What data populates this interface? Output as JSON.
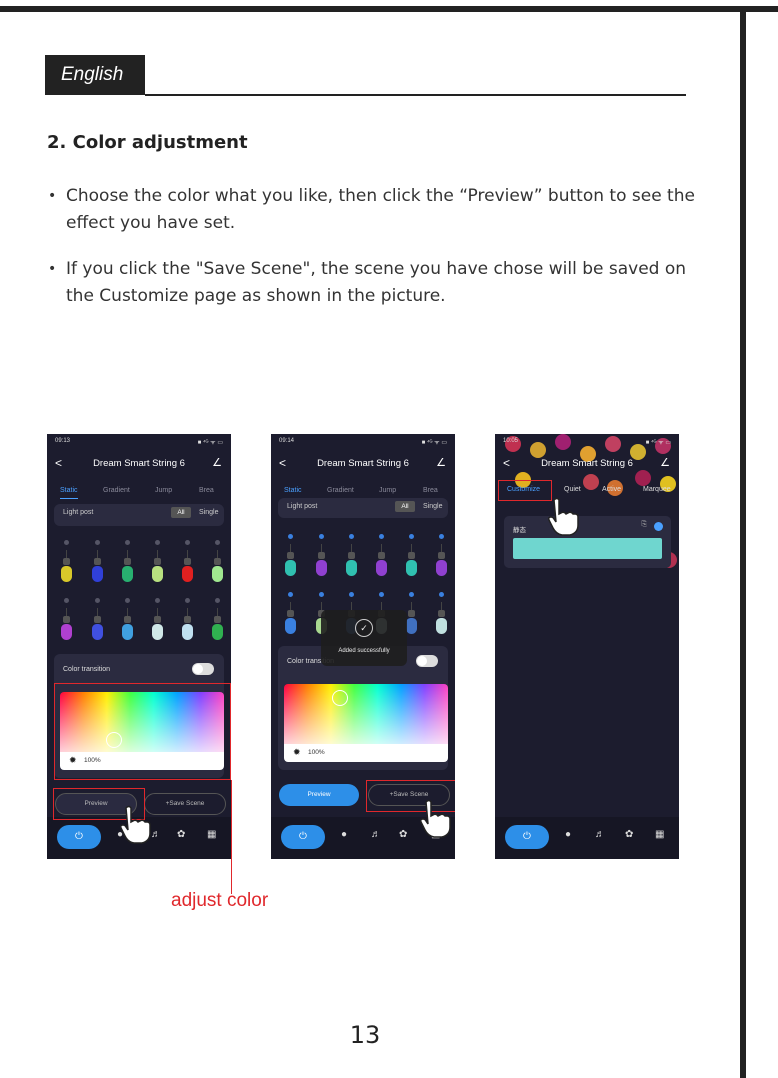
{
  "language_tab": "English",
  "section_heading": "2. Color adjustment",
  "bullets": [
    "Choose the color what you like, then click the “Preview” button to see the effect you have set.",
    "If you click the \"Save Scene\", the scene you have chose will be saved on the Customize page as shown in the picture."
  ],
  "bullet_glyph": "•",
  "callout": "adjust color",
  "page_number": "13",
  "phones": [
    {
      "status_time": "09:13",
      "status_right": "■ ⁴ᴳ ᯤ ▭",
      "back": "<",
      "title": "Dream Smart String 6",
      "edit": "∠",
      "tabs": [
        "Static",
        "Gradient",
        "Jump",
        "Brea"
      ],
      "light_post": "Light post",
      "all": "All",
      "single": "Single",
      "color_transition": "Color transition",
      "brightness": "100%",
      "preview": "Preview",
      "save_scene": "+Save Scene"
    },
    {
      "status_time": "09:14",
      "status_right": "■ ⁴ᴳ ᯤ ▭",
      "back": "<",
      "title": "Dream Smart String 6",
      "edit": "∠",
      "tabs": [
        "Static",
        "Gradient",
        "Jump",
        "Brea"
      ],
      "light_post": "Light post",
      "all": "All",
      "single": "Single",
      "toast": "Added successfully",
      "color_transition": "Color transition",
      "brightness": "100%",
      "preview": "Preview",
      "save_scene": "+Save Scene"
    },
    {
      "status_time": "10:05",
      "status_right": "■ ⁴ᴳ ᯤ ▭",
      "back": "<",
      "title": "Dream Smart String 6",
      "edit": "∠",
      "tabs": [
        "Customize",
        "Quiet",
        "Active",
        "Marquee"
      ],
      "scene_name": "静态"
    }
  ],
  "colors": {
    "accent_blue": "#2d8fe8",
    "highlight_red": "#e0282c",
    "scene_teal": "#6fd6cf",
    "app_bg": "#1c1c2e"
  },
  "icons": [
    "power-icon",
    "bulb-icon",
    "music-icon",
    "palette-icon",
    "grid-icon",
    "hand-pointer-icon",
    "checkmark-icon",
    "sun-icon",
    "back-arrow-icon",
    "edit-icon"
  ]
}
